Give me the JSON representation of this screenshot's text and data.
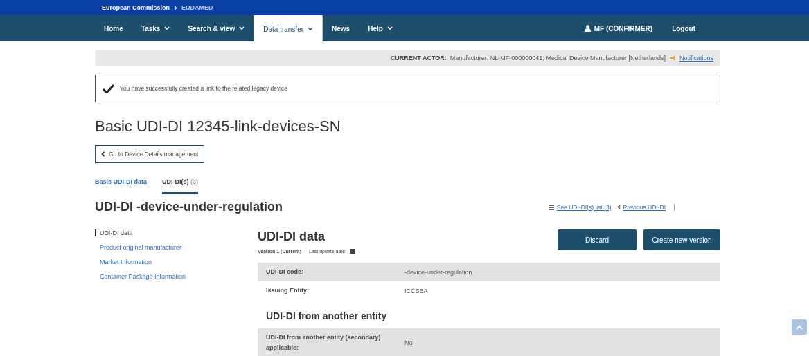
{
  "breadcrumb": [
    {
      "label": "European Commission"
    },
    {
      "label": "EUDAMED"
    }
  ],
  "nav": {
    "items": [
      {
        "label": "Home",
        "dropdown": false,
        "selected": false
      },
      {
        "label": "Tasks",
        "dropdown": true,
        "selected": false
      },
      {
        "label": "Search & view",
        "dropdown": true,
        "selected": false
      },
      {
        "label": "Data transfer",
        "dropdown": true,
        "selected": true
      },
      {
        "label": "News",
        "dropdown": false,
        "selected": false
      },
      {
        "label": "Help",
        "dropdown": true,
        "selected": false
      }
    ],
    "user": "MF (CONFIRMER)",
    "logout": "Logout"
  },
  "actor": {
    "label": "CURRENT ACTOR:",
    "value": "Manufacturer: NL-MF-000000041; Medical Device Manufacturer [Netherlands]",
    "link": "Notifications"
  },
  "alert": {
    "message": "You have successfully created a link to the related legacy device"
  },
  "title": "Basic UDI-DI 12345-link-devices-SN",
  "back_button": "Go to Device Details management",
  "tabs": [
    {
      "label": "Basic UDI-DI data",
      "selected": false
    },
    {
      "label": "UDI-DI(s)",
      "count": "(3)",
      "selected": true
    }
  ],
  "subtitle": "UDI-DI -device-under-regulation",
  "list_link": "See UDI-DI(s) list (3)",
  "previous_link": "Previous UDI-DI",
  "side_nav": [
    {
      "label": "UDI-DI data",
      "selected": true
    },
    {
      "label": "Product original manufacturer",
      "selected": false
    },
    {
      "label": "Market Information",
      "selected": false
    },
    {
      "label": "Container Package Information",
      "selected": false
    }
  ],
  "section": {
    "title": "UDI-DI data",
    "version": "Version 1",
    "status": "(Current)",
    "last_update_label": "Last update date:",
    "last_update_value": "-",
    "buttons": [
      "Discard",
      "Create new version"
    ],
    "rows": [
      {
        "kind": "field",
        "label": "UDI-DI code:",
        "value": "-device-under-regulation",
        "shaded": true
      },
      {
        "kind": "field",
        "label": "Issuing Entity:",
        "value": "ICCBBA",
        "shaded": false
      },
      {
        "kind": "heading",
        "label": "UDI-DI from another entity"
      },
      {
        "kind": "field",
        "label": "UDI-DI from another entity (secondary) applicable:",
        "value": "No",
        "shaded": true
      }
    ]
  }
}
